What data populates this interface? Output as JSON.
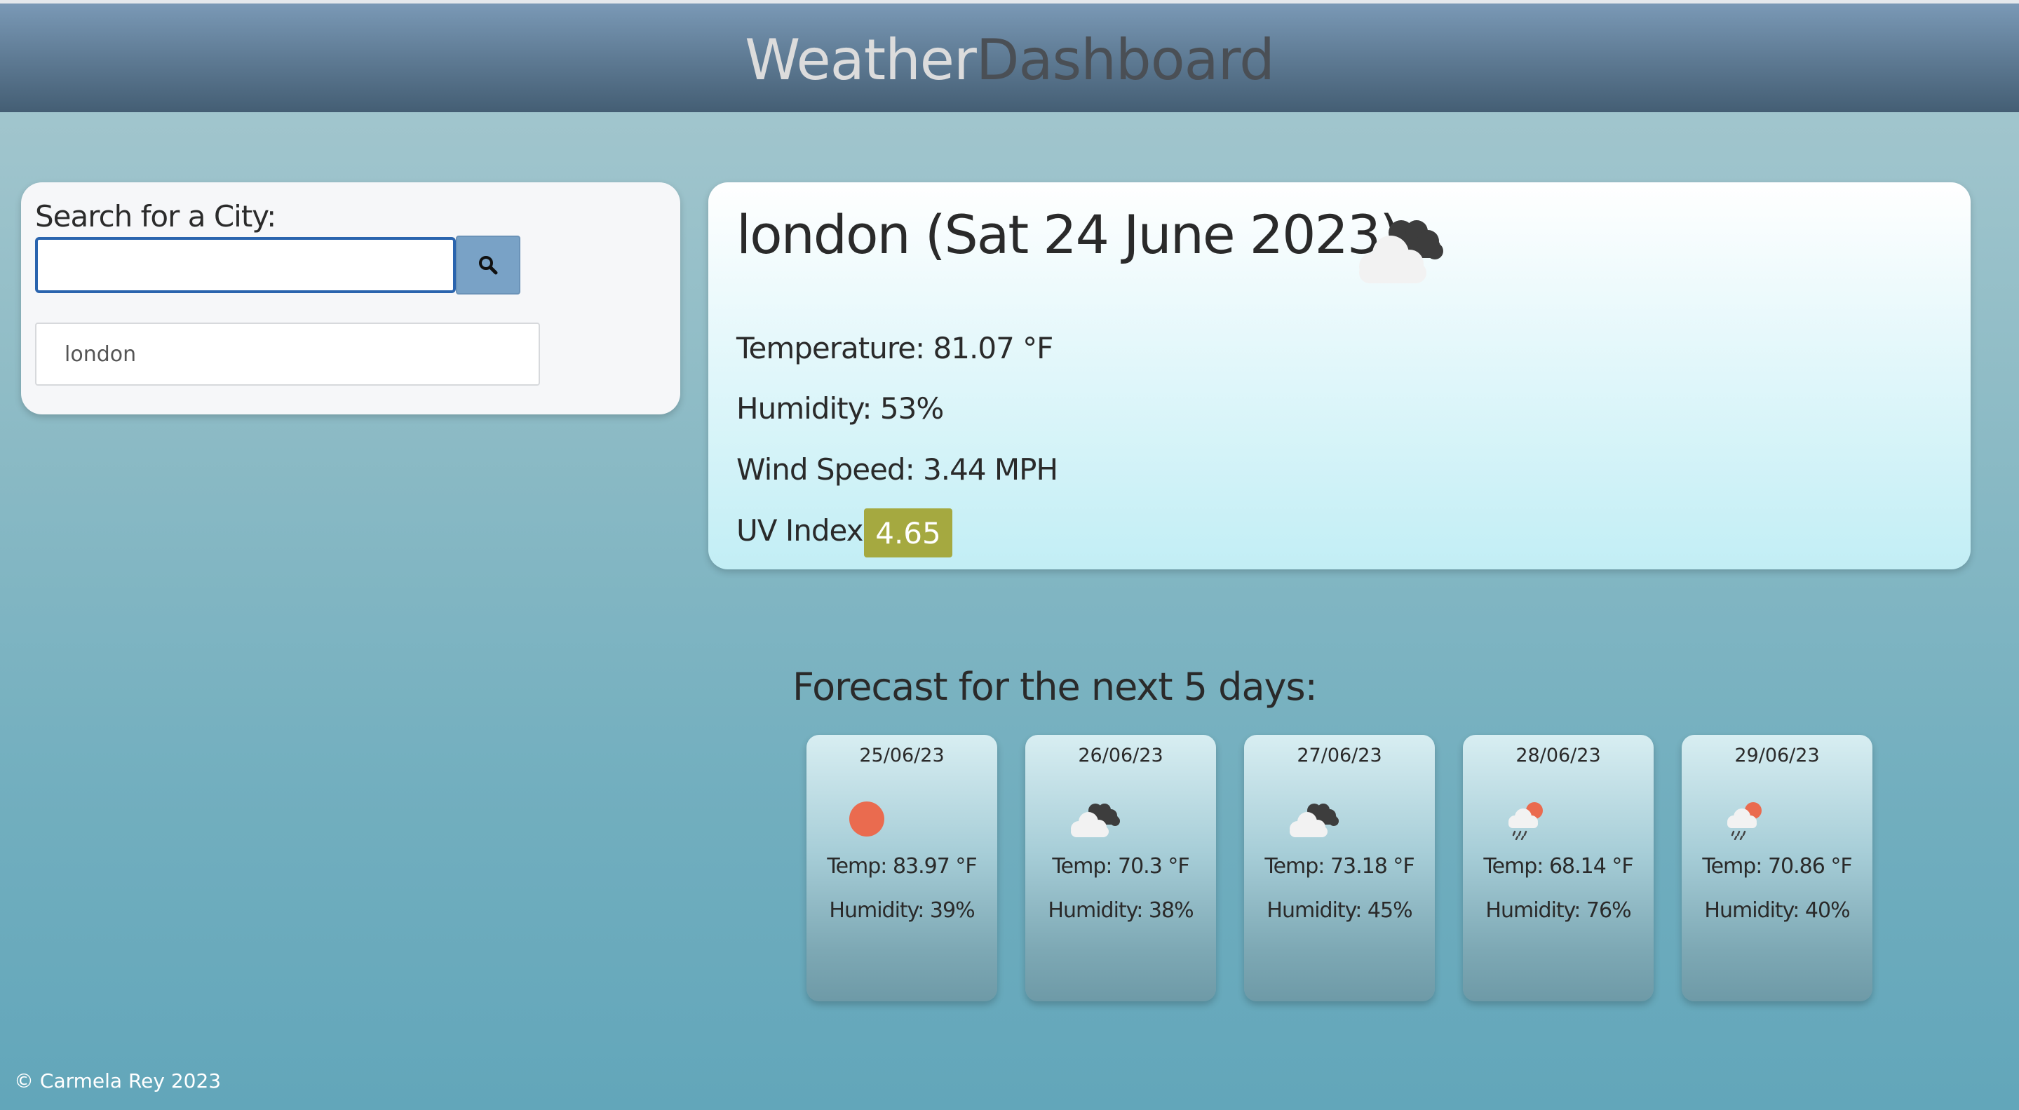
{
  "header": {
    "title_part1": "Weather",
    "title_part2": "Dashboard"
  },
  "search": {
    "label": "Search for a City:",
    "input_value": "",
    "button_icon": "search-icon",
    "history": [
      "london"
    ]
  },
  "current": {
    "heading": "london (Sat 24 June 2023)",
    "icon": "broken-clouds-icon",
    "temperature": "Temperature: 81.07 °F",
    "humidity": "Humidity: 53%",
    "wind": "Wind Speed: 3.44 MPH",
    "uv_label": "UV Index:",
    "uv_value": "4.65",
    "uv_color": "#a5a940"
  },
  "forecast": {
    "title": "Forecast for the next 5 days:",
    "days": [
      {
        "date": "25/06/23",
        "icon": "clear-sun-icon",
        "temp": "Temp: 83.97 °F",
        "humidity": "Humidity: 39%"
      },
      {
        "date": "26/06/23",
        "icon": "broken-clouds-icon",
        "temp": "Temp: 70.3 °F",
        "humidity": "Humidity: 38%"
      },
      {
        "date": "27/06/23",
        "icon": "broken-clouds-icon",
        "temp": "Temp: 73.18 °F",
        "humidity": "Humidity: 45%"
      },
      {
        "date": "28/06/23",
        "icon": "sun-rain-icon",
        "temp": "Temp: 68.14 °F",
        "humidity": "Humidity: 76%"
      },
      {
        "date": "29/06/23",
        "icon": "sun-rain-icon",
        "temp": "Temp: 70.86 °F",
        "humidity": "Humidity: 40%"
      }
    ]
  },
  "footer": {
    "text": "© Carmela Rey 2023"
  }
}
